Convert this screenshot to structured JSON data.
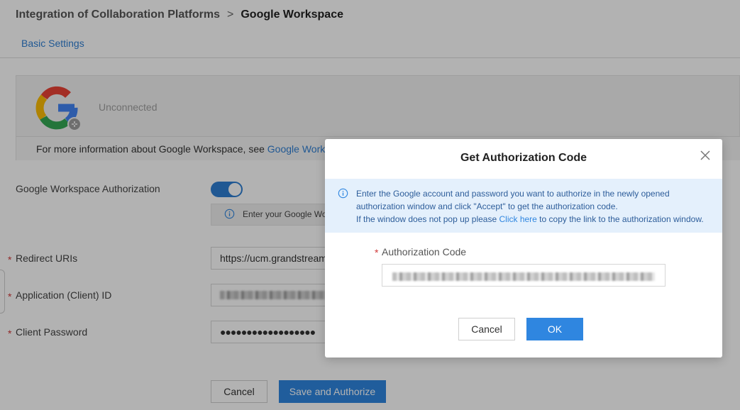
{
  "breadcrumb": {
    "parent": "Integration of Collaboration Platforms",
    "separator": ">",
    "current": "Google Workspace"
  },
  "tabs": {
    "basic": "Basic Settings"
  },
  "info_card": {
    "status": "Unconnected",
    "more_info_text": "For more information about Google Workspace, see ",
    "more_info_link": "Google Works"
  },
  "form": {
    "authorization_label": "Google Workspace Authorization",
    "authorization_enabled": true,
    "hint": "Enter your Google Wo",
    "redirect_label": "Redirect URIs",
    "redirect_value": "https://ucm.grandstream",
    "client_id_label": "Application (Client) ID",
    "client_password_label": "Client Password",
    "client_password_value": "●●●●●●●●●●●●●●●●●●",
    "required_mark": "*",
    "cancel": "Cancel",
    "save": "Save and Authorize"
  },
  "modal": {
    "title": "Get Authorization Code",
    "info_line1": "Enter the Google account and password you want to authorize in the newly opened",
    "info_line2": "authorization window and click \"Accept\" to get the authorization code.",
    "info_line3_prefix": "If the window does not pop up please ",
    "info_link": "Click here",
    "info_line3_suffix": " to copy the link to the authorization window.",
    "code_label": "Authorization Code",
    "required_mark": "*",
    "cancel": "Cancel",
    "ok": "OK"
  },
  "colors": {
    "accent": "#2f86e0",
    "link": "#2f7fd3",
    "required": "#d03a3a",
    "info_bg": "#e4f0fc"
  },
  "icons": {
    "close": "close-icon",
    "info": "info-icon",
    "logo": "google-logo",
    "unlink": "unlink-icon"
  }
}
